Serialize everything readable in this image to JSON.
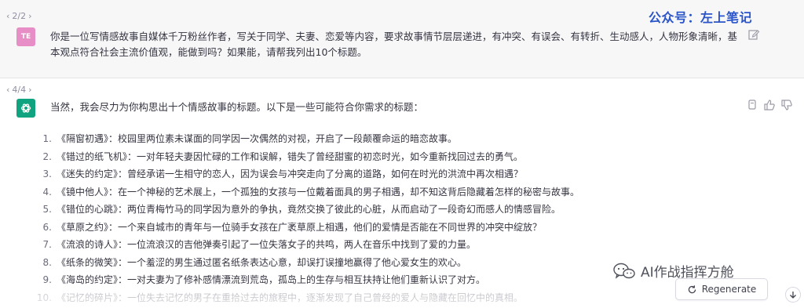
{
  "user_message": {
    "pager": "2/2",
    "avatar": "TE",
    "text": "你是一位写情感故事自媒体千万粉丝作者，写关于同学、夫妻、恋爱等内容，要求故事情节层层递进，有冲突、有误会、有转折、生动感人，人物形象清晰，基本观点符合社会主流价值观，能做到吗？如果能，请帮我列出10个标题。"
  },
  "assistant_message": {
    "pager": "4/4",
    "intro": "当然，我会尽力为你构思出十个情感故事的标题。以下是一些可能符合你需求的标题：",
    "titles": [
      {
        "num": "1.",
        "text": "《隔窗初遇》：校园里两位素未谋面的同学因一次偶然的对视，开启了一段颠覆命运的暗恋故事。"
      },
      {
        "num": "2.",
        "text": "《错过的纸飞机》：一对年轻夫妻因忙碌的工作和误解，错失了曾经甜蜜的初恋时光，如今重新找回过去的勇气。"
      },
      {
        "num": "3.",
        "text": "《迷失的约定》：曾经承诺一生相守的恋人，因为误会与冲突走向了分离的道路，如何在时光的洪流中再次相遇？"
      },
      {
        "num": "4.",
        "text": "《镜中他人》：在一个神秘的艺术展上，一个孤独的女孩与一位戴着面具的男子相遇，却不知这背后隐藏着怎样的秘密与故事。"
      },
      {
        "num": "5.",
        "text": "《错位的心跳》：两位青梅竹马的同学因为意外的争执，竟然交换了彼此的心脏，从而启动了一段奇幻而感人的情感冒险。"
      },
      {
        "num": "6.",
        "text": "《草原之约》：一个来自城市的青年与一位骑手女孩在广袤草原上相遇，他们的爱情是否能在不同世界的冲突中绽放？"
      },
      {
        "num": "7.",
        "text": "《流浪的诗人》：一位流浪汉的吉他弹奏引起了一位失落女子的共鸣，两人在音乐中找到了爱的力量。"
      },
      {
        "num": "8.",
        "text": "《纸条的微笑》：一个羞涩的男生通过匿名纸条表达心意，却误打误撞地赢得了他心爱女生的欢心。"
      },
      {
        "num": "9.",
        "text": "《海岛的约定》：一对夫妻为了修补感情漂流到荒岛，孤岛上的生存与相互扶持让他们重新认识了对方。"
      },
      {
        "num": "10.",
        "text": "《记忆的碎片》：一位失去记忆的男子在重拾过去的旅程中，逐渐发现了自己曾经的爱人与隐藏在回忆中的真相。"
      }
    ]
  },
  "regenerate_label": "Regenerate",
  "watermarks": {
    "top": "公众号：左上笔记",
    "bottom": "AI作战指挥方舱"
  },
  "icons": {
    "pager_prev": "chevron-left-icon",
    "pager_next": "chevron-right-icon",
    "edit": "pencil-icon",
    "copy": "copy-icon",
    "thumbs_up": "thumbs-up-icon",
    "thumbs_down": "thumbs-down-icon",
    "regenerate": "refresh-icon",
    "scroll_down": "arrow-down-icon",
    "wechat": "wechat-icon",
    "openai": "openai-logo-icon"
  },
  "colors": {
    "user_bg": "#f7f7f8",
    "user_avatar": "#e88ec7",
    "ai_avatar": "#10a37f",
    "watermark_blue": "#2a55c9"
  }
}
